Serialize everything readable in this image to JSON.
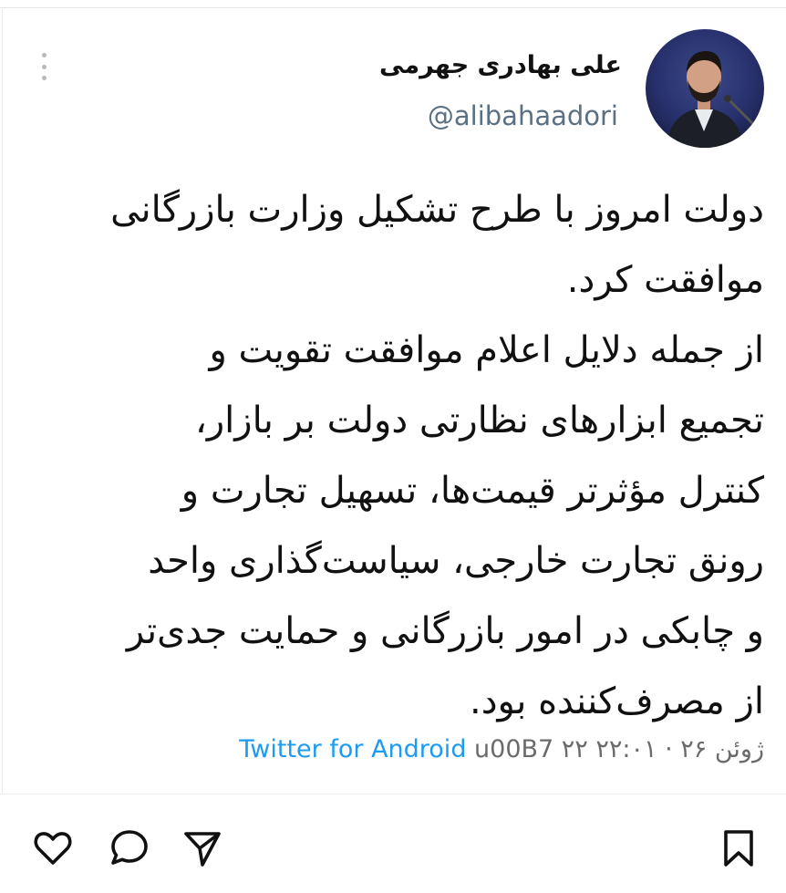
{
  "tweet": {
    "author_name": "علی بهادری جهرمی",
    "handle": "@alibahaadori",
    "lines": [
      "دولت امروز با طرح تشکیل وزارت بازرگانی",
      "موافقت کرد.",
      "از جمله دلایل اعلام موافقت تقویت و",
      "تجمیع ابزارهای نظارتی دولت بر بازار،",
      "کنترل مؤثرتر قیمت‌ها، تسهیل تجارت و",
      "رونق تجارت خارجی، سیاست‌گذاری واحد",
      "و چابکی در امور بازرگانی و حمایت جدی‌تر",
      "از مصرف‌کننده بود."
    ],
    "source": "Twitter for Android",
    "timestamp": "u00B7 ۲۲ ژوئن ۲۶ · ۲۲:۰۱"
  },
  "icons": {
    "more": "more-vertical-icon",
    "like": "heart-icon",
    "comment": "comment-icon",
    "share": "send-icon",
    "save": "bookmark-icon"
  },
  "colors": {
    "link": "#1d9bf0",
    "handle": "#5b7083",
    "text": "#111111"
  }
}
